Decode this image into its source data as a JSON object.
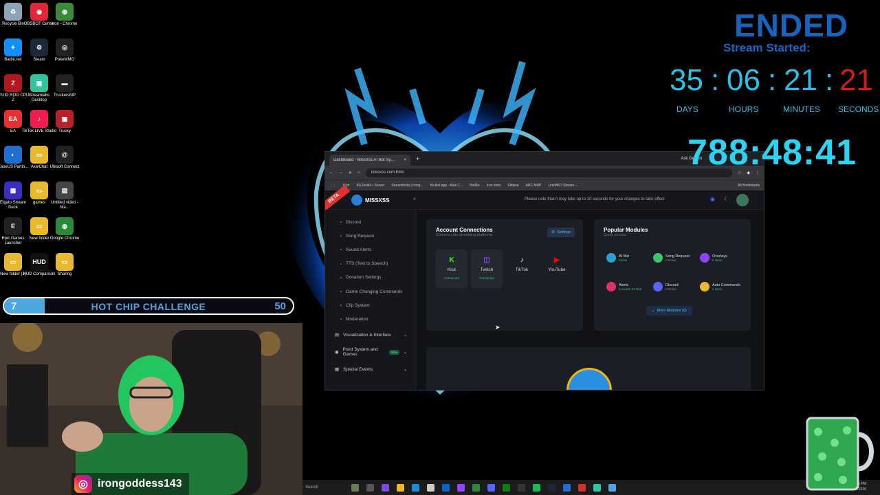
{
  "desktop_icons": [
    {
      "label": "Recycle Bin",
      "color": "#8fa3b8",
      "glyph": "♻"
    },
    {
      "label": "OBSBOT Center",
      "color": "#e0263a",
      "glyph": "◉"
    },
    {
      "label": "Iron - Chrome",
      "color": "#3a8a3a",
      "glyph": "◍"
    },
    {
      "label": "Battle.net",
      "color": "#148eff",
      "glyph": "✦"
    },
    {
      "label": "Steam",
      "color": "#1b2838",
      "glyph": "⚙"
    },
    {
      "label": "PokeMMO",
      "color": "#222222",
      "glyph": "◎"
    },
    {
      "label": "CPUID ROG CPU-Z",
      "color": "#b0181e",
      "glyph": "Z"
    },
    {
      "label": "Streamlabs Desktop",
      "color": "#31c3a2",
      "glyph": "▣"
    },
    {
      "label": "TruckersMP",
      "color": "#222222",
      "glyph": "▬"
    },
    {
      "label": "EA",
      "color": "#e8312f",
      "glyph": "EA"
    },
    {
      "label": "TikTok LIVE Studio",
      "color": "#ee1d52",
      "glyph": "♪"
    },
    {
      "label": "Trucky",
      "color": "#b8202a",
      "glyph": "▦"
    },
    {
      "label": "EaseUS Partiti...",
      "color": "#1f6fd1",
      "glyph": "◐"
    },
    {
      "label": "AxelChat",
      "color": "#e8b82e",
      "glyph": "▭"
    },
    {
      "label": "Ubisoft Connect",
      "color": "#222222",
      "glyph": "@"
    },
    {
      "label": "Elgato Stream Deck",
      "color": "#3b2fbf",
      "glyph": "▦"
    },
    {
      "label": "games",
      "color": "#e8b82e",
      "glyph": "▭"
    },
    {
      "label": "Untitled video - Ma...",
      "color": "#444444",
      "glyph": "▤"
    },
    {
      "label": "Epic Games Launcher",
      "color": "#222222",
      "glyph": "E"
    },
    {
      "label": "New folder",
      "color": "#e8b82e",
      "glyph": "▭"
    },
    {
      "label": "Google Chrome",
      "color": "#2a8a3a",
      "glyph": "◍"
    },
    {
      "label": "New folder (2)",
      "color": "#e8b82e",
      "glyph": "▭"
    },
    {
      "label": "HUD Comparison",
      "color": "#111111",
      "glyph": "HUD"
    },
    {
      "label": "Sharing",
      "color": "#e8b82e",
      "glyph": "▭"
    }
  ],
  "countdown": {
    "status": "ENDED",
    "caption": "Stream Started:",
    "days": "35",
    "hours": "06",
    "minutes": "21",
    "seconds": "21",
    "sep": ":",
    "labels": {
      "days": "DAYS",
      "hours": "HOURS",
      "minutes": "MINUTES",
      "seconds": "SECONDS"
    },
    "elapsed": "788:48:41"
  },
  "browser": {
    "tab_title": "Dashboard - MissXss AI Bot Sy...",
    "tab_close": "×",
    "new_tab": "+",
    "right_tab": "Ask Gemini",
    "url": "missxss.com.tr/en",
    "bookmarks": [
      "Kick",
      "IRLToolkit • Server",
      "Streamloots | Irong...",
      "Kicklet.app - Kick C...",
      "BotRix",
      "Iron stats",
      "Eklipse",
      "ARC MAP",
      "LinxMKD Stream -..."
    ],
    "all_bookmarks": "All Bookmarks"
  },
  "app": {
    "beta": "BETA",
    "logo": "MISSXSS",
    "notice": "Please note that it may take up to 10 seconds for your changes to take effect",
    "sidebar_items": [
      "Discord",
      "Song Request",
      "Sound Alerts",
      "TTS (Text to Speech)",
      "Donation Settings",
      "Game Changing Commands",
      "Clip System",
      "Moderation"
    ],
    "sidebar_groups": [
      {
        "label": "Visualization & Interface",
        "badge": ""
      },
      {
        "label": "Point System and Games",
        "badge": "New"
      },
      {
        "label": "Special Events",
        "badge": ""
      }
    ],
    "account_connections": {
      "title": "Account Connections",
      "subtitle": "Connect your streaming platforms",
      "settings": "Settings",
      "platforms": [
        {
          "name": "Kick",
          "status": "Connected",
          "color": "#53fc18",
          "glyph": "K",
          "connected": true
        },
        {
          "name": "Twitch",
          "status": "Connected",
          "color": "#9146ff",
          "glyph": "◫",
          "connected": true
        },
        {
          "name": "TikTok",
          "status": "",
          "color": "#ffffff",
          "glyph": "♪",
          "connected": false
        },
        {
          "name": "YouTube",
          "status": "",
          "color": "#ff0000",
          "glyph": "▶",
          "connected": false
        }
      ]
    },
    "popular_modules": {
      "title": "Popular Modules",
      "subtitle": "Quick access",
      "modules": [
        {
          "name": "AI Bot",
          "status": "Active",
          "color": "#2a9fd6"
        },
        {
          "name": "Song Request",
          "status": "Inactive",
          "color": "#3ec46d"
        },
        {
          "name": "Overlays",
          "status": "6 items",
          "color": "#8e44ff"
        },
        {
          "name": "Alerts",
          "status": "5 sound, 14 chat",
          "color": "#e0306a"
        },
        {
          "name": "Discord",
          "status": "Inactive",
          "color": "#5865f2"
        },
        {
          "name": "Auto Commands",
          "status": "4 items",
          "color": "#e8b82e"
        }
      ],
      "more": "More Modules (6)"
    }
  },
  "challenge": {
    "current": "7",
    "title": "HOT CHIP CHALLENGE",
    "max": "50",
    "progress": 0.14
  },
  "social": {
    "handle": "irongoddess143"
  },
  "taskbar": {
    "search": "Search",
    "time": "...21 PM",
    "date": "...17/2026"
  }
}
